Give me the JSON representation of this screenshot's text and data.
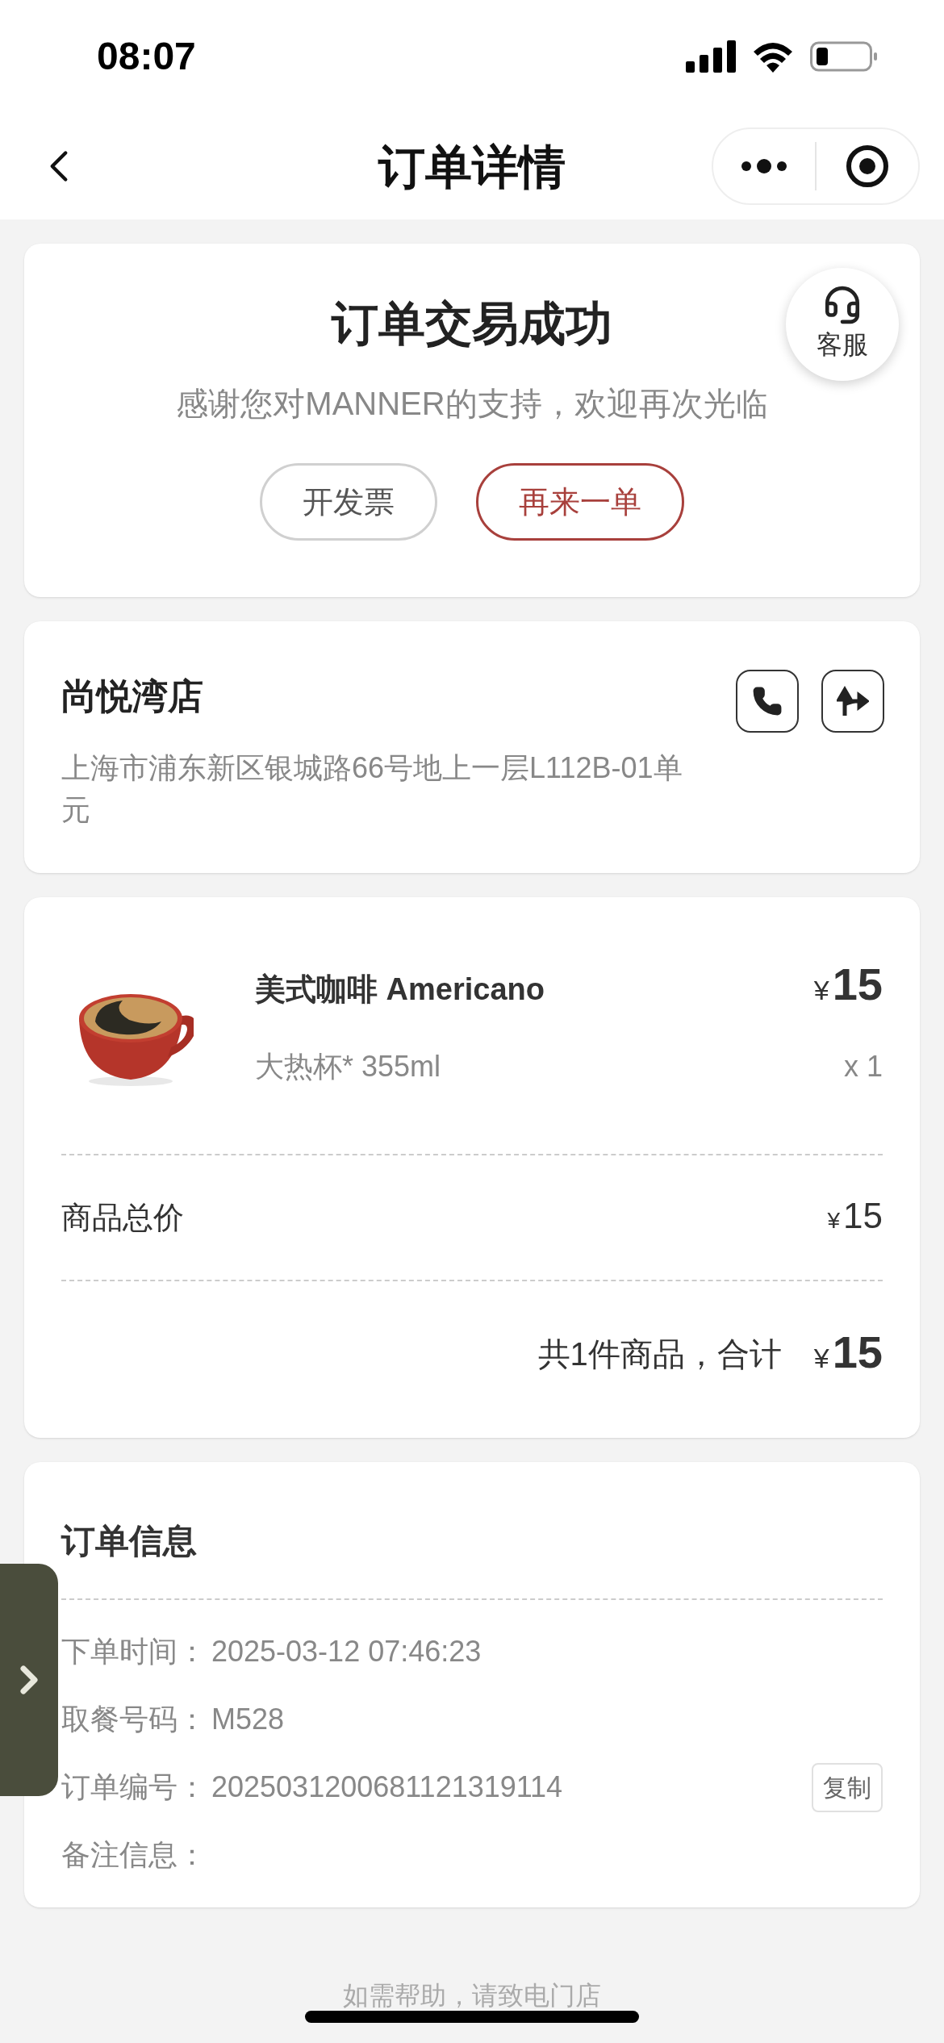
{
  "status_bar": {
    "time": "08:07"
  },
  "nav": {
    "title": "订单详情"
  },
  "result": {
    "title": "订单交易成功",
    "message": "感谢您对MANNER的支持，欢迎再次光临",
    "service_label": "客服",
    "buttons": [
      {
        "label": "开发票",
        "kind": "plain"
      },
      {
        "label": "再来一单",
        "kind": "primary"
      }
    ]
  },
  "store": {
    "name": "尚悦湾店",
    "address": "上海市浦东新区银城路66号地上一层L112B-01单元"
  },
  "order_items": [
    {
      "kind": "picture",
      "name": "美式咖啡 Americano",
      "currency": "¥",
      "price": "15",
      "spec": "大热杯* 355ml",
      "quantity": "x 1"
    }
  ],
  "subtotal": {
    "label": "商品总价",
    "currency": "¥",
    "amount": "15"
  },
  "total": {
    "label": "共1件商品，合计",
    "currency": "¥",
    "amount": "15"
  },
  "order_info": {
    "title": "订单信息",
    "rows": [
      {
        "label": "下单时间：",
        "value": "2025-03-12 07:46:23"
      },
      {
        "label": "取餐号码：",
        "value": "M528"
      },
      {
        "label": "订单编号：",
        "value": "2025031200681121319114",
        "copy": "复制"
      },
      {
        "label": "备注信息："
      }
    ]
  },
  "footer": {
    "text": "如需帮助，请致电门店"
  }
}
